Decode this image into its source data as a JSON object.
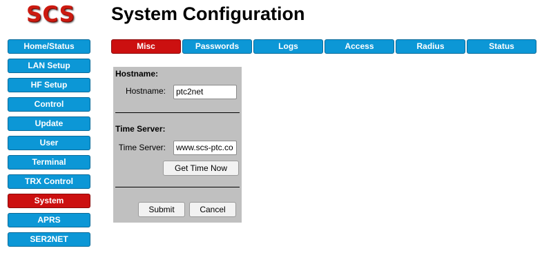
{
  "logo": "SCS",
  "page_title": "System Configuration",
  "sidebar": {
    "items": [
      {
        "label": "Home/Status",
        "active": false
      },
      {
        "label": "LAN Setup",
        "active": false
      },
      {
        "label": "HF Setup",
        "active": false
      },
      {
        "label": "Control",
        "active": false
      },
      {
        "label": "Update",
        "active": false
      },
      {
        "label": "User",
        "active": false
      },
      {
        "label": "Terminal",
        "active": false
      },
      {
        "label": "TRX Control",
        "active": false
      },
      {
        "label": "System",
        "active": true
      },
      {
        "label": "APRS",
        "active": false
      },
      {
        "label": "SER2NET",
        "active": false
      }
    ]
  },
  "tabs": [
    {
      "label": "Misc",
      "active": true
    },
    {
      "label": "Passwords",
      "active": false
    },
    {
      "label": "Logs",
      "active": false
    },
    {
      "label": "Access",
      "active": false
    },
    {
      "label": "Radius",
      "active": false
    },
    {
      "label": "Status",
      "active": false
    }
  ],
  "form": {
    "hostname_section": "Hostname:",
    "hostname_label": "Hostname:",
    "hostname_value": "ptc2net",
    "timeserver_section": "Time Server:",
    "timeserver_label": "Time Server:",
    "timeserver_value": "www.scs-ptc.co",
    "get_time_label": "Get Time Now",
    "submit_label": "Submit",
    "cancel_label": "Cancel"
  },
  "colors": {
    "nav_button": "#0c97d6",
    "nav_active": "#cc1010",
    "logo": "#cc1a10",
    "panel": "#c0c0c0"
  }
}
